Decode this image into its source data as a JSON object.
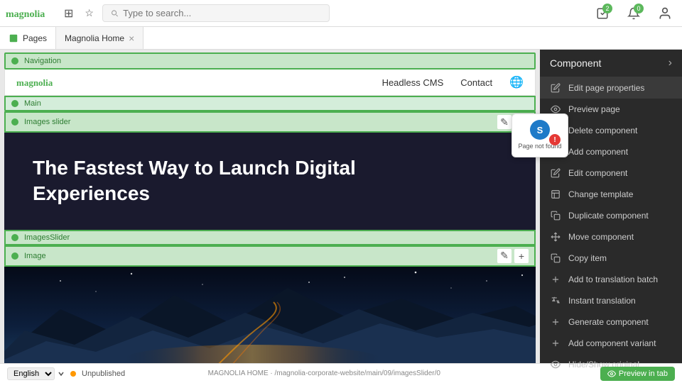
{
  "topbar": {
    "search_placeholder": "Type to search...",
    "grid_icon": "⊞",
    "star_icon": "☆",
    "tasks_badge": "2",
    "notif_badge": "0",
    "user_icon": "person"
  },
  "tabs": {
    "pages_label": "Pages",
    "active_tab_label": "Magnolia Home",
    "close_icon": "×"
  },
  "page": {
    "nav_label": "Navigation",
    "website_nav": {
      "logo_text": "magnolia",
      "links": [
        "Headless CMS",
        "Contact"
      ]
    },
    "main_label": "Main",
    "images_slider_label": "Images slider",
    "hero_title": "The Fastest Way to Launch Digital Experiences",
    "images_slider_bottom_label": "ImagesSlider",
    "image_label": "Image",
    "edit_icon": "✎",
    "add_icon": "+"
  },
  "right_panel": {
    "title": "Component",
    "chevron": "›",
    "menu_items": [
      {
        "id": "edit-page-properties",
        "icon": "pencil",
        "label": "Edit page properties",
        "has_close": false,
        "highlighted": true
      },
      {
        "id": "preview-page",
        "icon": "eye",
        "label": "Preview page",
        "has_close": false,
        "highlighted": false
      },
      {
        "id": "delete-component",
        "icon": "x",
        "label": "Delete component",
        "has_close": false,
        "highlighted": false
      },
      {
        "id": "add-component",
        "icon": "plus",
        "label": "Add component",
        "has_close": false,
        "highlighted": false
      },
      {
        "id": "edit-component",
        "icon": "pencil",
        "label": "Edit component",
        "has_close": false,
        "highlighted": false
      },
      {
        "id": "change-template",
        "icon": "template",
        "label": "Change template",
        "has_close": false,
        "highlighted": false
      },
      {
        "id": "duplicate-component",
        "icon": "copy",
        "label": "Duplicate component",
        "has_close": false,
        "highlighted": false
      },
      {
        "id": "move-component",
        "icon": "move",
        "label": "Move component",
        "has_close": false,
        "highlighted": false
      },
      {
        "id": "copy-item",
        "icon": "copy",
        "label": "Copy item",
        "has_close": false,
        "highlighted": false
      },
      {
        "id": "add-translation-batch",
        "icon": "plus",
        "label": "Add to translation batch",
        "has_close": false,
        "highlighted": false
      },
      {
        "id": "instant-translation",
        "icon": "translate",
        "label": "Instant translation",
        "has_close": false,
        "highlighted": false
      },
      {
        "id": "generate-component",
        "icon": "plus",
        "label": "Generate component",
        "has_close": false,
        "highlighted": false
      },
      {
        "id": "add-component-variant",
        "icon": "plus",
        "label": "Add component variant",
        "has_close": false,
        "highlighted": false
      },
      {
        "id": "hide-show-original",
        "icon": "eye",
        "label": "Hide/Show original",
        "has_close": false,
        "highlighted": false
      }
    ]
  },
  "bottom_bar": {
    "language": "English",
    "status_label": "Unpublished",
    "path": "MAGNOLIA HOME · /magnolia-corporate-website/main/09/imagesSlider/0",
    "preview_label": "Preview in tab"
  }
}
